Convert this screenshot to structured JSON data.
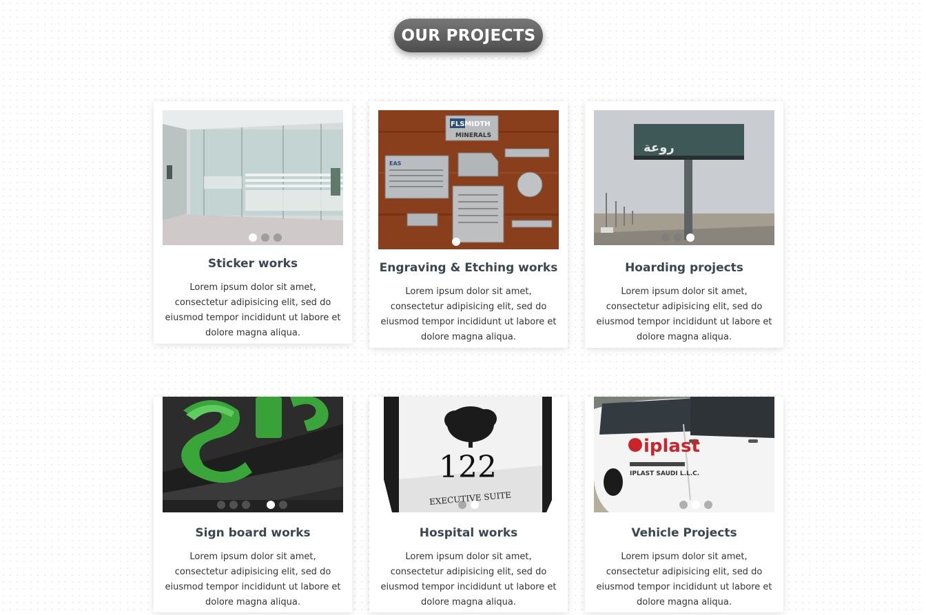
{
  "section": {
    "title": "OUR PROJECTS"
  },
  "projects": [
    {
      "title": "Sticker works",
      "description": "Lorem ipsum dolor sit amet, consectetur adipisicing elit, sed do eiusmod tempor incididunt ut labore et dolore magna aliqua.",
      "image": "glass-office-partition-image",
      "slides": 3,
      "active_slide": 1
    },
    {
      "title": "Engraving & Etching works",
      "description": "Lorem ipsum dolor sit amet, consectetur adipisicing elit, sed do eiusmod tempor incididunt ut labore et dolore magna aliqua.",
      "image": "metal-nameplates-image",
      "slides": 1,
      "active_slide": 1,
      "image_text": {
        "brand": "FLSMIDTH",
        "sub": "MINERALS",
        "plate": "EAS"
      }
    },
    {
      "title": "Hoarding projects",
      "description": "Lorem ipsum dolor sit amet, consectetur adipisicing elit, sed do eiusmod tempor incididunt ut labore et dolore magna aliqua.",
      "image": "roadside-billboard-image",
      "slides": 3,
      "active_slide": 3,
      "image_text": {
        "billboard": "روعة"
      }
    },
    {
      "title": "Sign board works",
      "description": "Lorem ipsum dolor sit amet, consectetur adipisicing elit, sed do eiusmod tempor incididunt ut labore et dolore magna aliqua.",
      "image": "green-3d-letters-image",
      "slides": 6,
      "active_slide": 5
    },
    {
      "title": "Hospital works",
      "description": "Lorem ipsum dolor sit amet, consectetur adipisicing elit, sed do eiusmod tempor incididunt ut labore et dolore magna aliqua.",
      "image": "room-number-sign-image",
      "slides": 2,
      "active_slide": 2,
      "image_text": {
        "number": "122",
        "caption": "EXECUTIVE SUITE"
      }
    },
    {
      "title": "Vehicle Projects",
      "description": "Lorem ipsum dolor sit amet, consectetur adipisicing elit, sed do eiusmod tempor incididunt ut labore et dolore magna aliqua.",
      "image": "branded-van-image",
      "slides": 3,
      "active_slide": 2,
      "image_text": {
        "brand": "iplast",
        "company": "IPLAST SAUDI L.L.C."
      }
    }
  ]
}
